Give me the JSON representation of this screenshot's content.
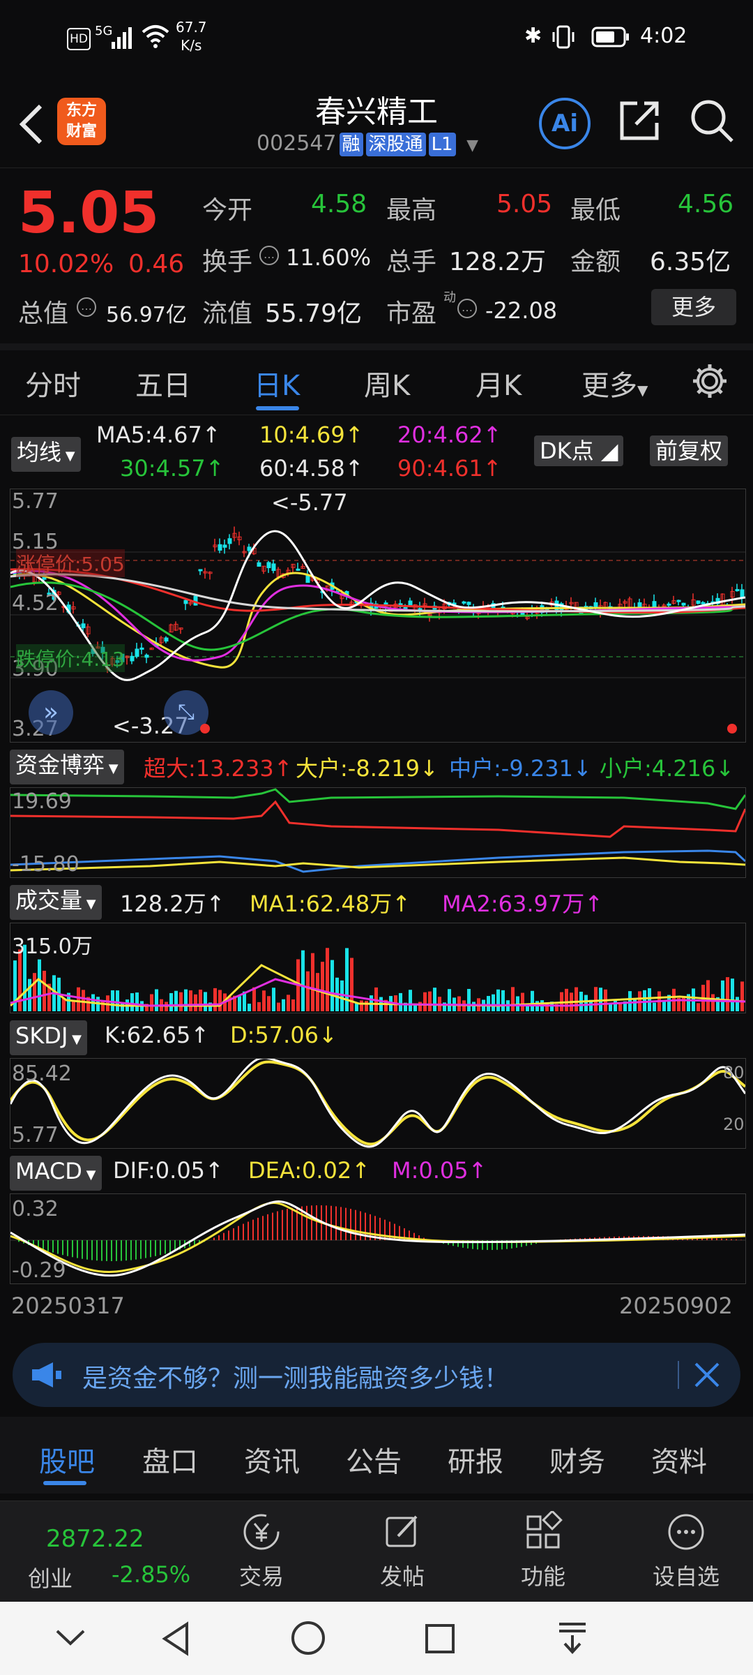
{
  "status": {
    "speed_value": "67.7",
    "speed_unit": "K/s",
    "time": "4:02",
    "signal_label": "5G",
    "hd_label": "HD"
  },
  "header": {
    "logo_line1": "东方",
    "logo_line2": "财富",
    "name": "春兴精工",
    "code": "002547",
    "tag_rong": "融",
    "tag_sgt": "深股通",
    "tag_l1": "L1",
    "ai_label": "Ai"
  },
  "quote": {
    "price": "5.05",
    "pct": "10.02%",
    "chg": "0.46",
    "open_label": "今开",
    "open": "4.58",
    "high_label": "最高",
    "high": "5.05",
    "low_label": "最低",
    "low": "4.56",
    "turnover_label": "换手",
    "turnover": "11.60%",
    "volume_label": "总手",
    "volume": "128.2万",
    "amount_label": "金额",
    "amount": "6.35亿",
    "mcap_label": "总值",
    "mcap": "56.97亿",
    "float_label": "流值",
    "float_cap": "55.79亿",
    "pe_label": "市盈",
    "pe_sup": "动",
    "pe": "-22.08",
    "more_label": "更多"
  },
  "tabs": [
    "分时",
    "五日",
    "日K",
    "周K",
    "月K",
    "更多"
  ],
  "active_tab": "日K",
  "colors": {
    "up": "#f0302c",
    "down": "#27c43a",
    "cyan": "#19e3e8",
    "accent": "#3a86e8",
    "yellow": "#f5e33b",
    "magenta": "#e02fe0"
  },
  "kline": {
    "selector": "均线",
    "ma5": "MA5:4.67",
    "ma10": "10:4.69",
    "ma20": "20:4.62",
    "ma30": "30:4.57",
    "ma60": "60:4.58",
    "ma90": "90:4.61",
    "dk_label": "DK点",
    "fq_label": "前复权",
    "axis": [
      "5.77",
      "5.15",
      "4.52",
      "3.90",
      "3.27"
    ],
    "high_mark": "<-5.77",
    "low_mark": "<-3.27",
    "limit_up": "涨停价:5.05",
    "limit_down": "跌停价:4.13"
  },
  "fund": {
    "selector": "资金博弈",
    "big": "超大:13.233",
    "large": "大户:-8.219",
    "mid": "中户:-9.231",
    "small": "小户:4.216",
    "axis_top": "19.69",
    "axis_bottom": "-15.80"
  },
  "vol": {
    "selector": "成交量",
    "value": "128.2万",
    "ma1": "MA1:62.48万",
    "ma2": "MA2:63.97万",
    "axis_top": "315.0万"
  },
  "kdj": {
    "selector": "SKDJ",
    "k": "K:62.65",
    "d": "D:57.06",
    "axis_top": "85.42",
    "axis_bottom": "5.77",
    "level_hi": "80",
    "level_lo": "20"
  },
  "macd": {
    "selector": "MACD",
    "dif": "DIF:0.05",
    "dea": "DEA:0.02",
    "m": "M:0.05",
    "axis_top": "0.32",
    "axis_bottom": "-0.29"
  },
  "dates": {
    "start": "20250317",
    "end": "20250902"
  },
  "banner": {
    "text": "是资金不够？测一测我能融资多少钱！"
  },
  "subtabs": [
    "股吧",
    "盘口",
    "资讯",
    "公告",
    "研报",
    "财务",
    "资料"
  ],
  "bottom": {
    "index_value": "2872.22",
    "index_name": "创业",
    "index_pct": "-2.85%",
    "trade": "交易",
    "post": "发帖",
    "func": "功能",
    "watch": "设自选"
  }
}
